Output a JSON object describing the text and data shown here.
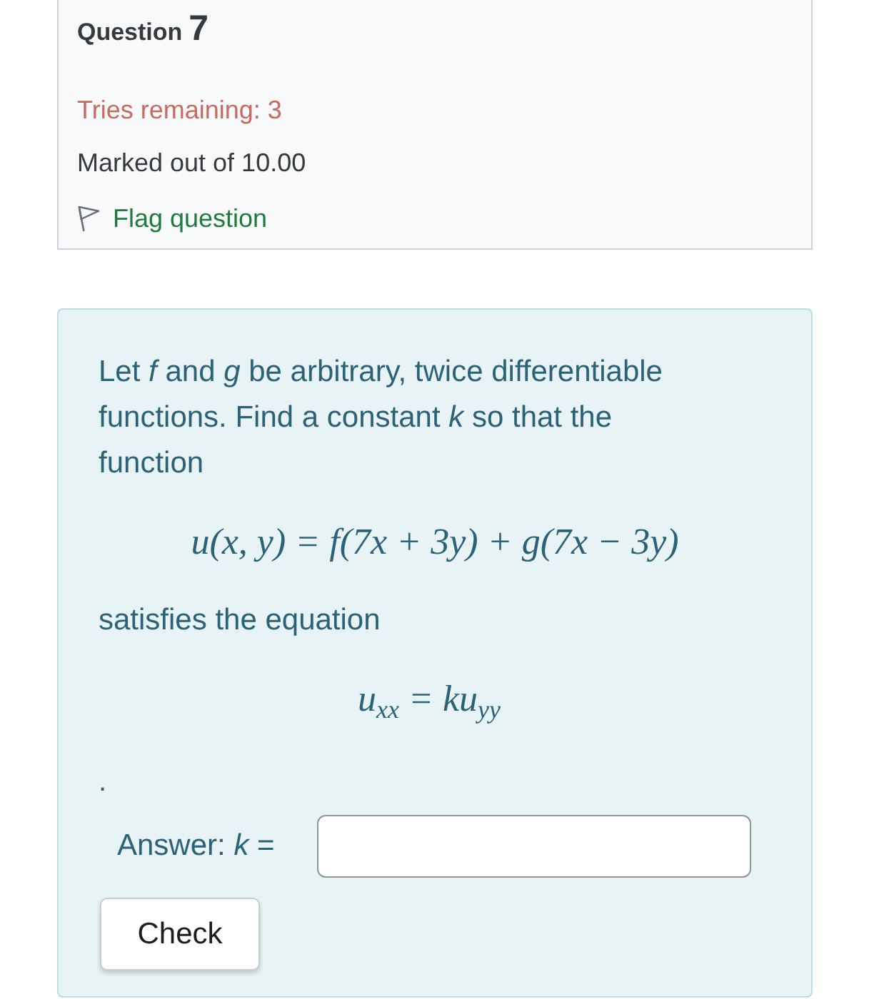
{
  "question": {
    "label": "Question",
    "number": "7"
  },
  "info": {
    "tries": "Tries remaining: 3",
    "marks": "Marked out of 10.00",
    "flag": {
      "label": "Flag question",
      "flagged": false
    }
  },
  "question_text": {
    "intro": "Let *f* and *g* be arbitrary, twice differentiable functions. Find a constant *k* so that the function",
    "formula_1": "u(x, y) = f(7x + 3y) + g(7x − 3y)",
    "middle": "satisfies the equation",
    "formula_2": "u$_{xx}$ = ku$_{yy}$",
    "end": "."
  },
  "answer": {
    "label": "Answer: *k* ="
  },
  "check_button": {
    "label": "Check"
  }
}
